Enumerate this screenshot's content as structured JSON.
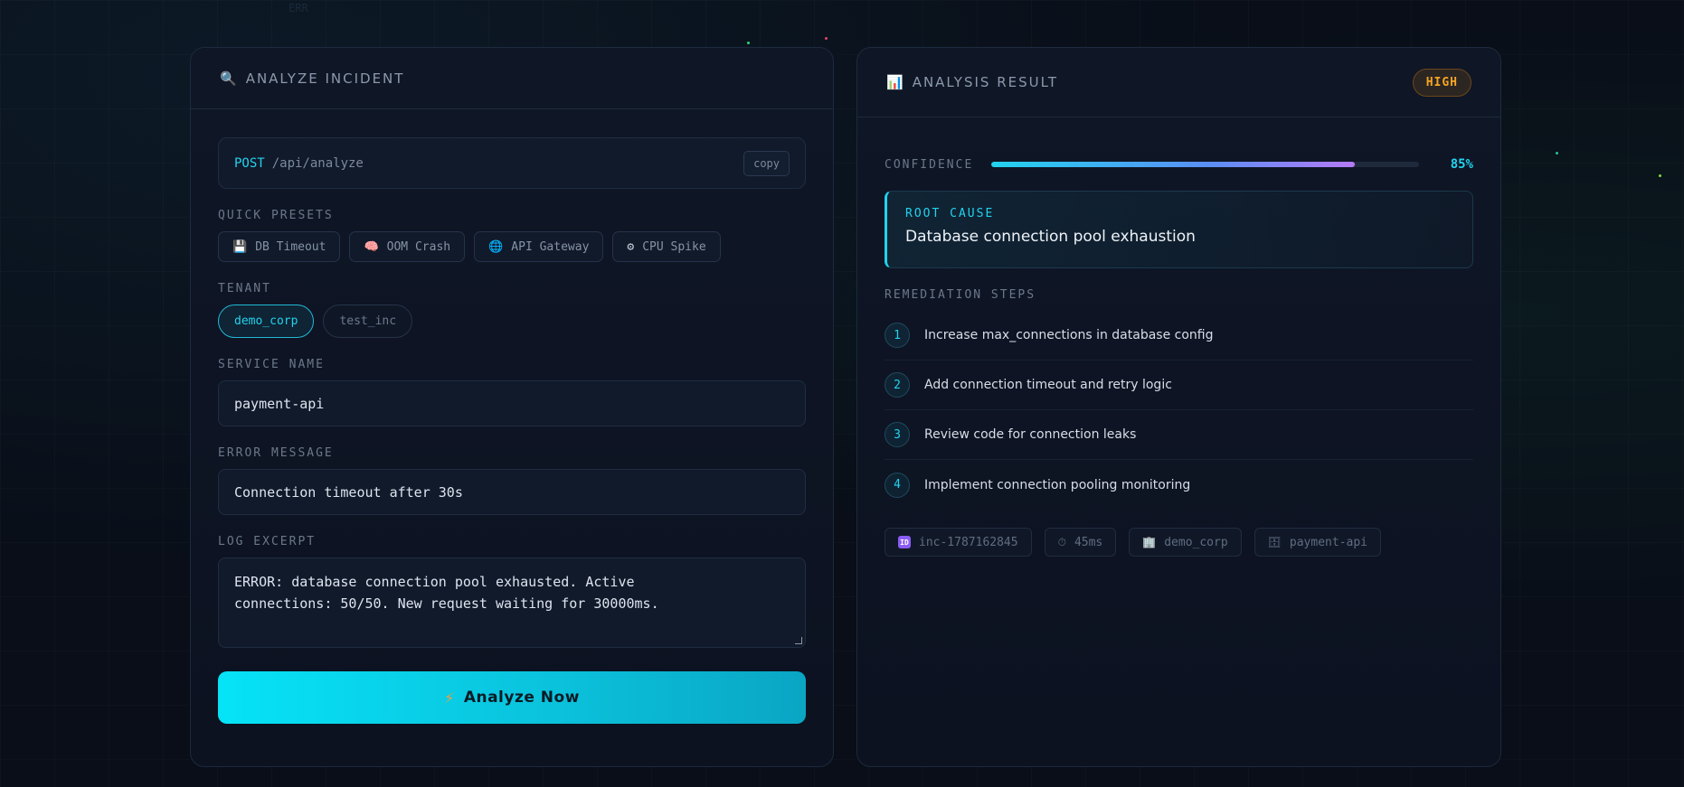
{
  "corner_tag": "ERR",
  "left_panel": {
    "title": "ANALYZE INCIDENT",
    "title_icon": "magnifier-icon",
    "endpoint": {
      "method": "POST",
      "path": "/api/analyze",
      "copy_label": "copy"
    },
    "presets_label": "QUICK PRESETS",
    "presets": [
      {
        "icon": "floppy-disk-icon",
        "glyph": "💾",
        "label": "DB Timeout"
      },
      {
        "icon": "brain-icon",
        "glyph": "🧠",
        "label": "OOM Crash"
      },
      {
        "icon": "globe-icon",
        "glyph": "🌐",
        "label": "API Gateway"
      },
      {
        "icon": "gear-icon",
        "glyph": "⚙",
        "label": "CPU Spike"
      }
    ],
    "tenant_label": "TENANT",
    "tenants": [
      {
        "label": "demo_corp",
        "active": true
      },
      {
        "label": "test_inc",
        "active": false
      }
    ],
    "service_label": "SERVICE NAME",
    "service_value": "payment-api",
    "error_label": "ERROR MESSAGE",
    "error_value": "Connection timeout after 30s",
    "log_label": "LOG EXCERPT",
    "log_value_line1": "ERROR: database connection pool exhausted. Active",
    "log_value_line2": "connections: 50/50. New request waiting for 30000ms.",
    "analyze_button": "Analyze Now",
    "analyze_icon": "lightning-bolt-icon"
  },
  "right_panel": {
    "title": "ANALYSIS RESULT",
    "title_icon": "bar-chart-icon",
    "severity": "HIGH",
    "confidence_label": "CONFIDENCE",
    "confidence_value": "85%",
    "confidence_fraction": 0.85,
    "root_cause_label": "ROOT CAUSE",
    "root_cause_text": "Database connection pool exhaustion",
    "remediation_label": "REMEDIATION STEPS",
    "steps": [
      {
        "num": "1",
        "text": "Increase max_connections in database config"
      },
      {
        "num": "2",
        "text": "Add connection timeout and retry logic"
      },
      {
        "num": "3",
        "text": "Review code for connection leaks"
      },
      {
        "num": "4",
        "text": "Implement connection pooling monitoring"
      }
    ],
    "meta": {
      "incident_id": "inc-1787162845",
      "duration": "45ms",
      "tenant": "demo_corp",
      "service": "payment-api"
    }
  },
  "colors": {
    "accent": "#22d3ee",
    "severity_high": "#f5a524",
    "background": "#090e18"
  }
}
